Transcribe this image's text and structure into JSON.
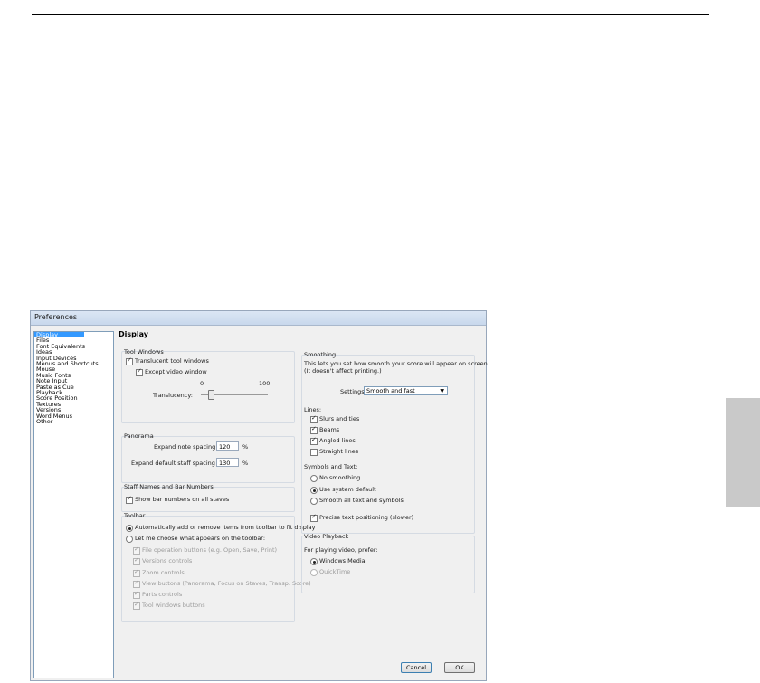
{
  "window": {
    "title": "Preferences"
  },
  "categories": [
    "Display",
    "Files",
    "Font Equivalents",
    "Ideas",
    "Input Devices",
    "Menus and Shortcuts",
    "Mouse",
    "Music Fonts",
    "Note Input",
    "Paste as Cue",
    "Playback",
    "Score Position",
    "Textures",
    "Versions",
    "Word Menus",
    "Other"
  ],
  "selected_category": "Display",
  "panel_title": "Display",
  "tool_windows": {
    "label": "Tool Windows",
    "translucent": "Translucent tool windows",
    "except_video": "Except video window",
    "slider_min": "0",
    "slider_max": "100",
    "translucency_label": "Translucency:",
    "translucency_value": 0.15
  },
  "panorama": {
    "label": "Panorama",
    "note_spacing_label": "Expand note spacing to:",
    "note_spacing_value": "120",
    "staff_spacing_label": "Expand default staff spacing to:",
    "staff_spacing_value": "130",
    "unit": "%"
  },
  "staff_names": {
    "label": "Staff Names and Bar Numbers",
    "show_bar_numbers": "Show bar numbers on all staves"
  },
  "toolbar": {
    "label": "Toolbar",
    "auto": "Automatically add or remove items from toolbar to fit display",
    "manual": "Let me choose what appears on the toolbar:",
    "items": [
      "File operation buttons (e.g. Open, Save, Print)",
      "Versions controls",
      "Zoom controls",
      "View buttons (Panorama, Focus on Staves, Transp. Score)",
      "Parts controls",
      "Tool windows buttons"
    ]
  },
  "smoothing": {
    "label": "Smoothing",
    "description": "This lets you set how smooth your score will appear on screen.",
    "description2": "(It doesn't affect printing.)",
    "settings_label": "Settings:",
    "settings_value": "Smooth and fast",
    "lines_label": "Lines:",
    "lines": [
      "Slurs and ties",
      "Beams",
      "Angled lines",
      "Straight lines"
    ],
    "symbols_label": "Symbols and Text:",
    "symbols": [
      "No smoothing",
      "Use system default",
      "Smooth all text and symbols"
    ],
    "precise": "Precise text positioning (slower)"
  },
  "video": {
    "label": "Video Playback",
    "prefer": "For playing video, prefer:",
    "options": [
      "Windows Media",
      "QuickTime"
    ]
  },
  "buttons": {
    "cancel": "Cancel",
    "ok": "OK"
  }
}
